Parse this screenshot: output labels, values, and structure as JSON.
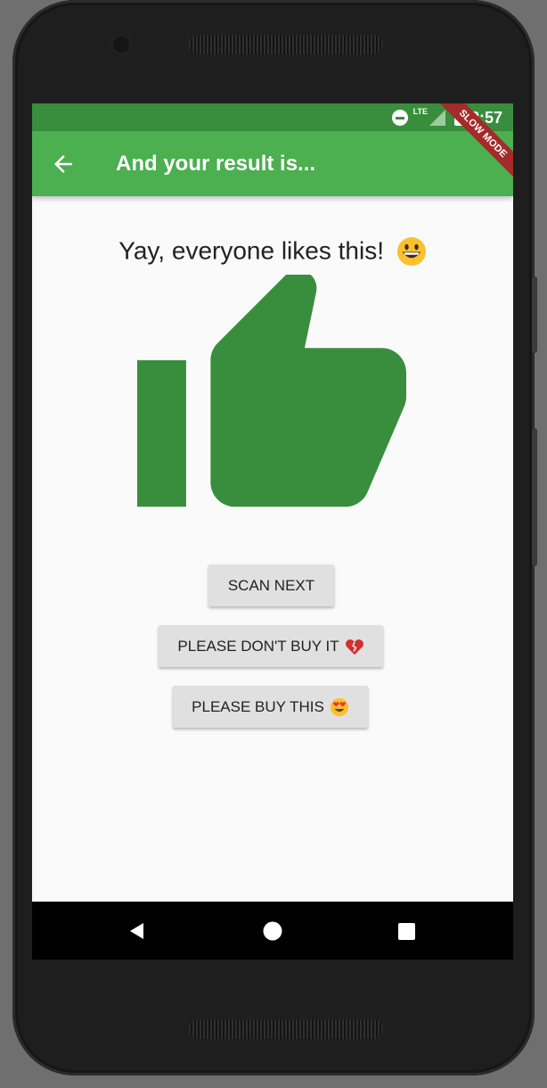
{
  "status_bar": {
    "network_label": "LTE",
    "time": "8:57"
  },
  "debug_banner": "SLOW MODE",
  "app_bar": {
    "back_icon": "arrow-back-icon",
    "title": "And your result is..."
  },
  "result": {
    "headline": "Yay, everyone likes this!",
    "headline_emoji": "grinning-face-icon",
    "verdict_icon": "thumbs-up-icon"
  },
  "actions": {
    "scan_next": "SCAN NEXT",
    "dont_buy": "PLEASE DON'T BUY IT",
    "dont_buy_emoji": "broken-heart-icon",
    "buy": "PLEASE BUY THIS",
    "buy_emoji": "heart-eyes-icon"
  },
  "nav_bar": {
    "back": "triangle-back-icon",
    "home": "circle-home-icon",
    "recents": "square-recents-icon"
  },
  "colors": {
    "primary": "#4caf50",
    "primary_dark": "#388e3c",
    "thumb": "#388e3c",
    "button": "#e0e0e0",
    "banner": "#a52a2a"
  }
}
